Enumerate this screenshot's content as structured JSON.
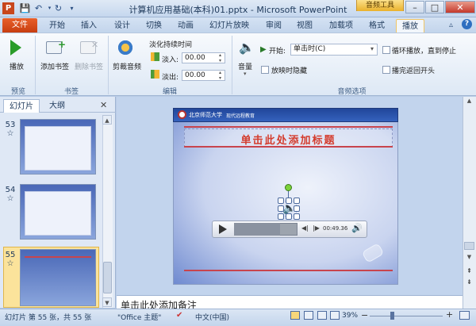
{
  "window": {
    "title": "计算机应用基础(本科)01.pptx - Microsoft PowerPoint",
    "context_tools": "音频工具",
    "minimize": "–",
    "maximize": "□",
    "close": "✕"
  },
  "tabs": {
    "file": "文件",
    "items": [
      "开始",
      "插入",
      "设计",
      "切换",
      "动画",
      "幻灯片放映",
      "审阅",
      "视图",
      "加载项",
      "格式",
      "播放"
    ]
  },
  "ribbon": {
    "preview": {
      "play": "播放",
      "group": "预览"
    },
    "bookmarks": {
      "add": "添加书签",
      "remove": "删除书签",
      "group": "书签"
    },
    "editing": {
      "trim": "剪裁音频",
      "fade_title": "淡化持续时间",
      "fade_in_label": "淡入:",
      "fade_in_value": "00.00",
      "fade_out_label": "淡出:",
      "fade_out_value": "00.00",
      "group": "编辑"
    },
    "audio_options": {
      "volume": "音量",
      "start_label": "开始:",
      "start_value": "单击时(C)",
      "loop": "循环播放，直到停止",
      "hide": "放映时隐藏",
      "rewind": "播完返回开头",
      "group": "音频选项"
    }
  },
  "left_panel": {
    "tab_slides": "幻灯片",
    "tab_outline": "大纲",
    "close": "✕",
    "slides": [
      {
        "num": "53"
      },
      {
        "num": "54"
      },
      {
        "num": "55"
      }
    ]
  },
  "slide": {
    "org": "北京师范大学",
    "subtitle": "现代远程教育",
    "title": "单击此处添加标题",
    "player_time": "00:49.36",
    "player_progress": 0.72
  },
  "notes": {
    "text": "单击此处添加备注"
  },
  "status": {
    "slide_info": "幻灯片 第 55 张，共 55 张",
    "theme": "\"Office 主题\"",
    "language": "中文(中国)",
    "zoom": "39%"
  },
  "colors": {
    "file_tab": "#d24e1c",
    "slide_header": "#2a53a8",
    "title_red": "#d43b2c"
  }
}
